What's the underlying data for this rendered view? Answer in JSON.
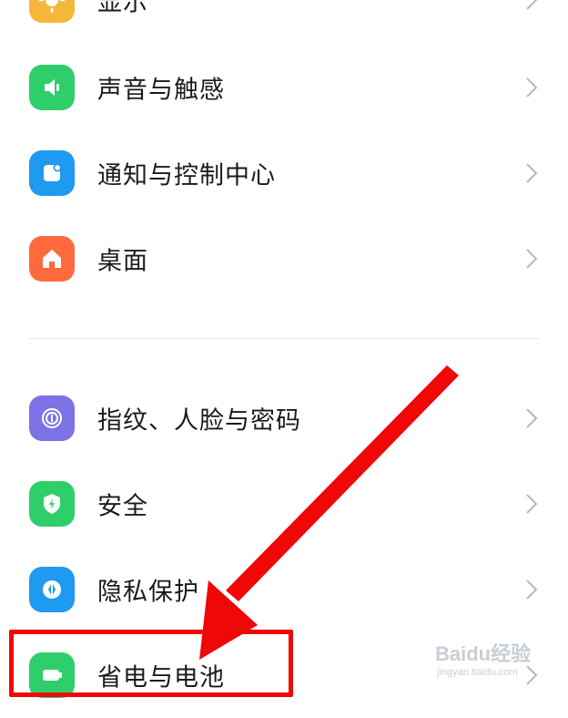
{
  "settings": {
    "items": [
      {
        "label": "显示",
        "icon": "display-icon",
        "color": "#f5b63c"
      },
      {
        "label": "声音与触感",
        "icon": "speaker-icon",
        "color": "#2ecf6b"
      },
      {
        "label": "通知与控制中心",
        "icon": "notification-icon",
        "color": "#1e9af0"
      },
      {
        "label": "桌面",
        "icon": "home-icon",
        "color": "#ff6a3d"
      },
      {
        "label": "指纹、人脸与密码",
        "icon": "fingerprint-icon",
        "color": "#7d72e6"
      },
      {
        "label": "安全",
        "icon": "shield-icon",
        "color": "#2ecf6b"
      },
      {
        "label": "隐私保护",
        "icon": "privacy-icon",
        "color": "#1e9af0"
      },
      {
        "label": "省电与电池",
        "icon": "battery-icon",
        "color": "#2ecf6b"
      }
    ]
  },
  "annotation": {
    "highlight_color": "#f00707",
    "highlighted_item": "省电与电池"
  },
  "watermark": {
    "brand": "Baidu经验",
    "sub": "jingyan.baidu.com"
  }
}
